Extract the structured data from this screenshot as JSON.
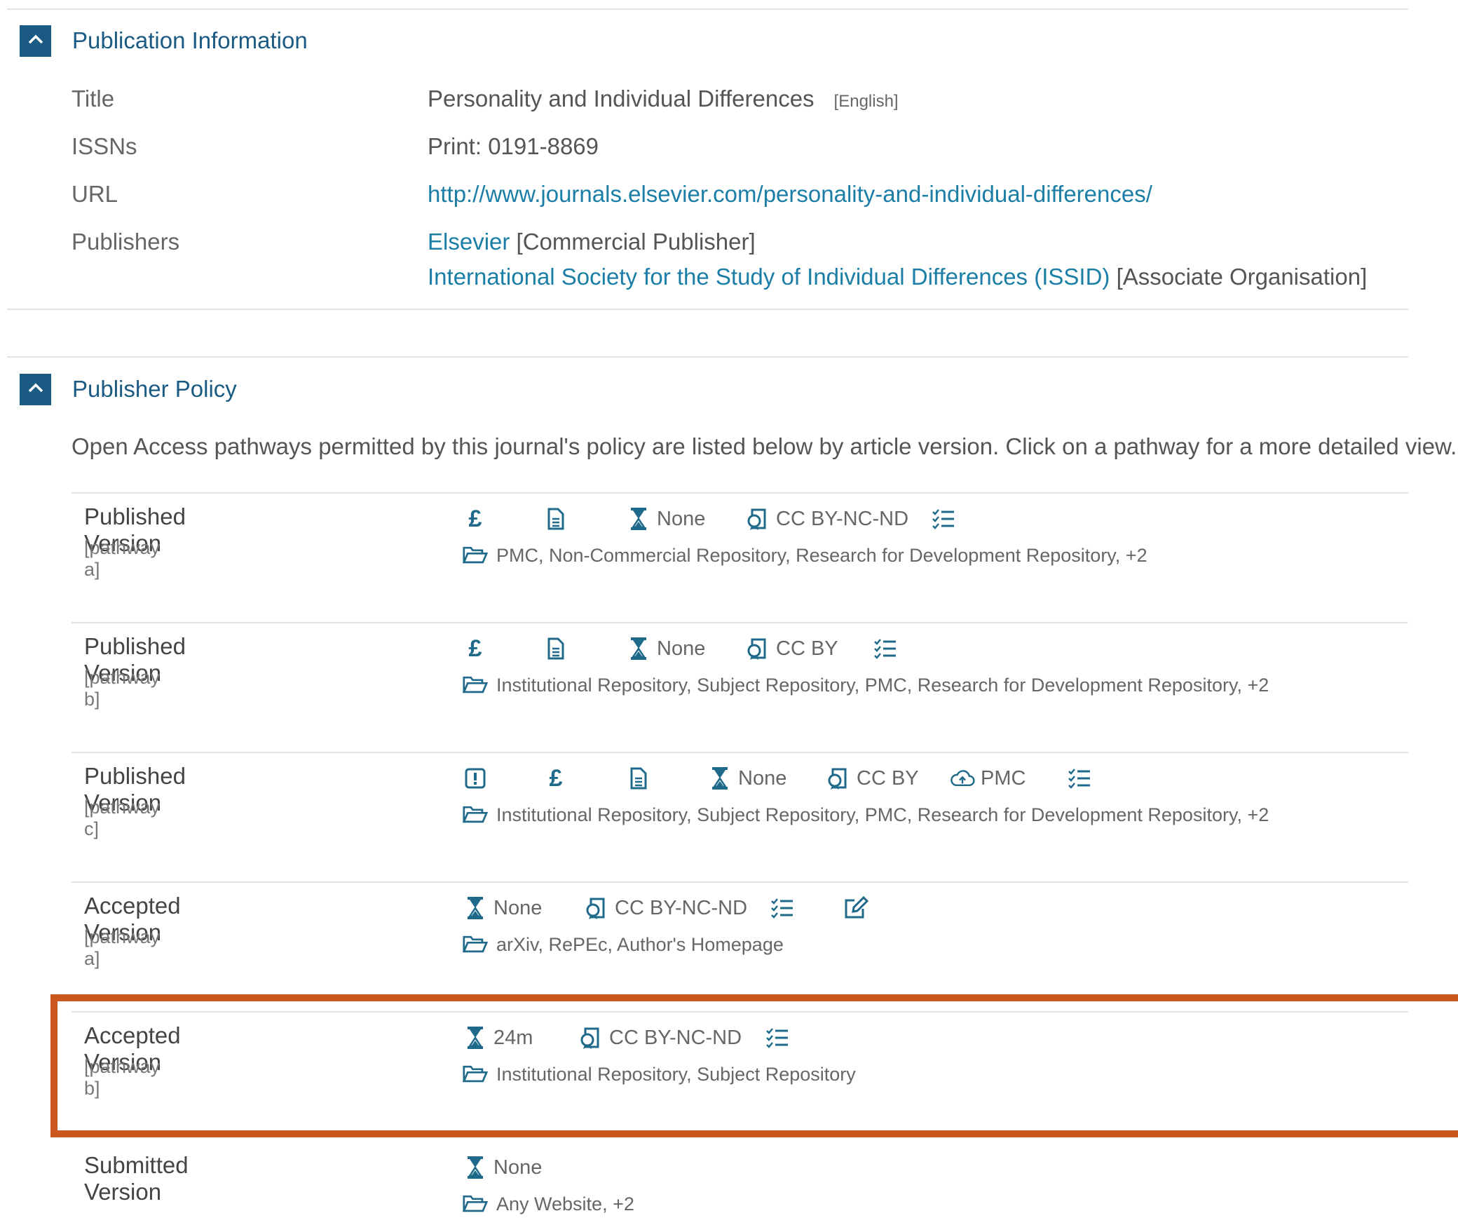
{
  "publication": {
    "heading": "Publication Information",
    "title_label": "Title",
    "title_value": "Personality and Individual Differences",
    "title_lang": "[English]",
    "issn_label": "ISSNs",
    "issn_value": "Print: 0191-8869",
    "url_label": "URL",
    "url_value": "http://www.journals.elsevier.com/personality-and-individual-differences/",
    "publishers_label": "Publishers",
    "publisher1_name": "Elsevier",
    "publisher1_role": "[Commercial Publisher]",
    "publisher2_name": "International Society for the Study of Individual Differences (ISSID)",
    "publisher2_role": "[Associate Organisation]"
  },
  "policy": {
    "heading": "Publisher Policy",
    "intro": "Open Access pathways permitted by this journal's policy are listed below by article version. Click on a pathway for a more detailed view."
  },
  "pathways": [
    {
      "version": "Published Version",
      "pathway": "[pathway a]",
      "icons": [
        {
          "icon": "pound-icon",
          "text": ""
        },
        {
          "icon": "document-icon",
          "text": ""
        },
        {
          "icon": "hourglass-icon",
          "text": "None"
        },
        {
          "icon": "license-icon",
          "text": "CC BY-NC-ND"
        },
        {
          "icon": "checklist-icon",
          "text": ""
        }
      ],
      "repositories": "PMC, Non-Commercial Repository, Research for Development Repository, +2"
    },
    {
      "version": "Published Version",
      "pathway": "[pathway b]",
      "icons": [
        {
          "icon": "pound-icon",
          "text": ""
        },
        {
          "icon": "document-icon",
          "text": ""
        },
        {
          "icon": "hourglass-icon",
          "text": "None"
        },
        {
          "icon": "license-icon",
          "text": "CC BY"
        },
        {
          "icon": "checklist-icon",
          "text": ""
        }
      ],
      "repositories": "Institutional Repository, Subject Repository, PMC, Research for Development Repository, +2"
    },
    {
      "version": "Published Version",
      "pathway": "[pathway c]",
      "icons": [
        {
          "icon": "alert-icon",
          "text": ""
        },
        {
          "icon": "pound-icon",
          "text": ""
        },
        {
          "icon": "document-icon",
          "text": ""
        },
        {
          "icon": "hourglass-icon",
          "text": "None"
        },
        {
          "icon": "license-icon",
          "text": "CC BY"
        },
        {
          "icon": "cloud-upload-icon",
          "text": "PMC"
        },
        {
          "icon": "checklist-icon",
          "text": ""
        }
      ],
      "repositories": "Institutional Repository, Subject Repository, PMC, Research for Development Repository, +2"
    },
    {
      "version": "Accepted Version",
      "pathway": "[pathway a]",
      "icons": [
        {
          "icon": "hourglass-icon",
          "text": "None"
        },
        {
          "icon": "license-icon",
          "text": "CC BY-NC-ND"
        },
        {
          "icon": "checklist-icon",
          "text": ""
        },
        {
          "icon": "edit-icon",
          "text": ""
        }
      ],
      "repositories": "arXiv, RePEc, Author's Homepage"
    },
    {
      "version": "Accepted Version",
      "pathway": "[pathway b]",
      "icons": [
        {
          "icon": "hourglass-icon",
          "text": "24m"
        },
        {
          "icon": "license-icon",
          "text": "CC BY-NC-ND"
        },
        {
          "icon": "checklist-icon",
          "text": ""
        }
      ],
      "repositories": "Institutional Repository, Subject Repository"
    },
    {
      "version": "Submitted Version",
      "pathway": "",
      "icons": [
        {
          "icon": "hourglass-icon",
          "text": "None"
        }
      ],
      "repositories": "Any Website, +2"
    }
  ],
  "colors": {
    "accent": "#1b5a82",
    "link": "#1b7ea6",
    "highlight": "#c9571e"
  }
}
